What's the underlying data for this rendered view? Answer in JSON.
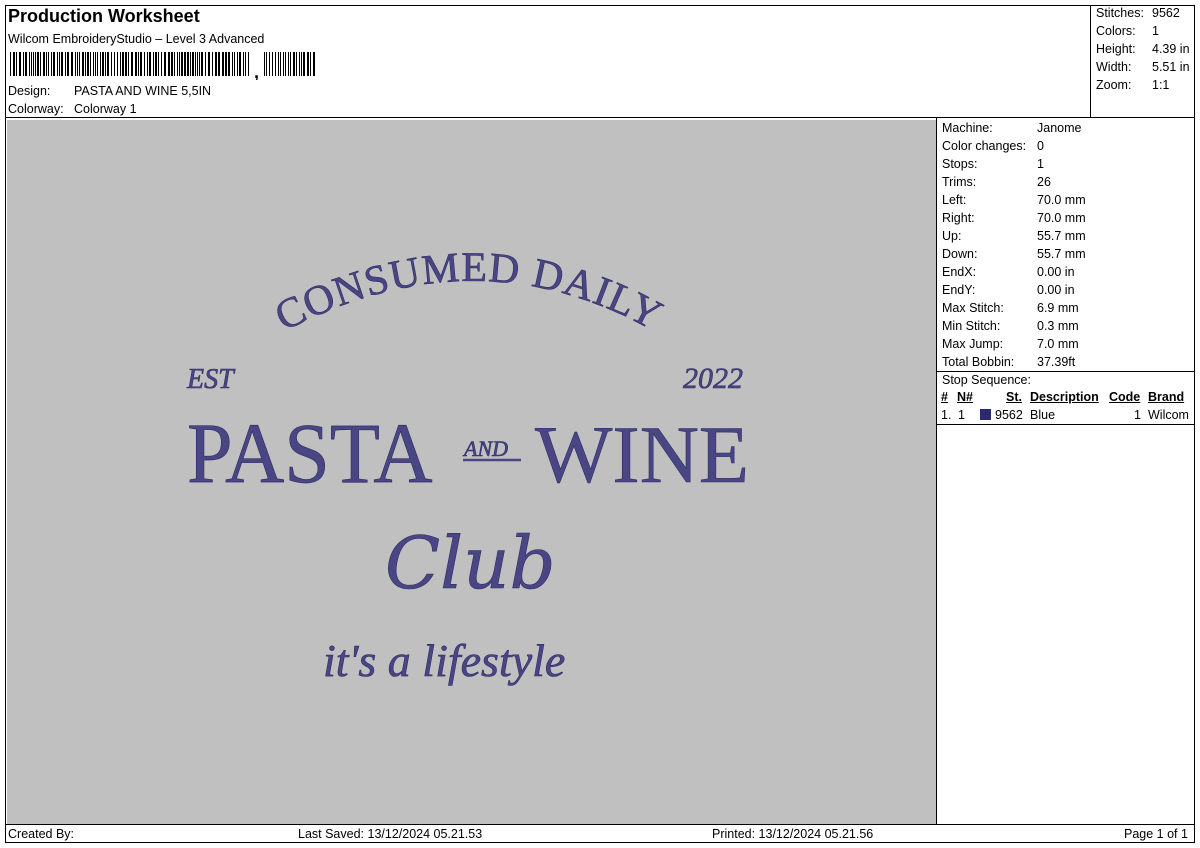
{
  "header": {
    "title": "Production Worksheet",
    "software": "Wilcom EmbroideryStudio – Level 3 Advanced",
    "barcode_suffix": ",",
    "design_label": "Design:",
    "design_value": "PASTA AND WINE 5,5IN",
    "colorway_label": "Colorway:",
    "colorway_value": "Colorway 1"
  },
  "summary": [
    {
      "label": "Stitches:",
      "value": "9562"
    },
    {
      "label": "Colors:",
      "value": "1"
    },
    {
      "label": "Height:",
      "value": "4.39 in"
    },
    {
      "label": "Width:",
      "value": "5.51 in"
    },
    {
      "label": "Zoom:",
      "value": "1:1"
    }
  ],
  "machine": [
    {
      "label": "Machine:",
      "value": "Janome"
    },
    {
      "label": "Color changes:",
      "value": "0"
    },
    {
      "label": "Stops:",
      "value": "1"
    },
    {
      "label": "Trims:",
      "value": "26"
    },
    {
      "label": "Left:",
      "value": "70.0 mm"
    },
    {
      "label": "Right:",
      "value": "70.0 mm"
    },
    {
      "label": "Up:",
      "value": "55.7 mm"
    },
    {
      "label": "Down:",
      "value": "55.7 mm"
    },
    {
      "label": "EndX:",
      "value": "0.00 in"
    },
    {
      "label": "EndY:",
      "value": "0.00 in"
    },
    {
      "label": "Max Stitch:",
      "value": "6.9 mm"
    },
    {
      "label": "Min Stitch:",
      "value": "0.3 mm"
    },
    {
      "label": "Max Jump:",
      "value": "7.0 mm"
    },
    {
      "label": "Total Bobbin:",
      "value": "37.39ft"
    }
  ],
  "stop_sequence": {
    "title": "Stop Sequence:",
    "headers": {
      "num": "#",
      "n": "N#",
      "st": "St.",
      "description": "Description",
      "code": "Code",
      "brand": "Brand"
    },
    "rows": [
      {
        "num": "1.",
        "n": "1",
        "color": "#2c2a6e",
        "st": "9562",
        "description": "Blue",
        "code": "1",
        "brand": "Wilcom"
      }
    ]
  },
  "design_art": {
    "thread_color": "#4a4684",
    "background_color": "#c0c0c0",
    "arc_text": "CONSUMED DAILY",
    "est": "EST",
    "year": "2022",
    "word1": "PASTA",
    "and": "AND",
    "word2": "WINE",
    "club": "Club",
    "tagline": "it's a lifestyle"
  },
  "footer": {
    "created_by": "Created By:",
    "last_saved": "Last Saved: 13/12/2024 05.21.53",
    "printed": "Printed: 13/12/2024 05.21.56",
    "page": "Page 1 of 1"
  }
}
